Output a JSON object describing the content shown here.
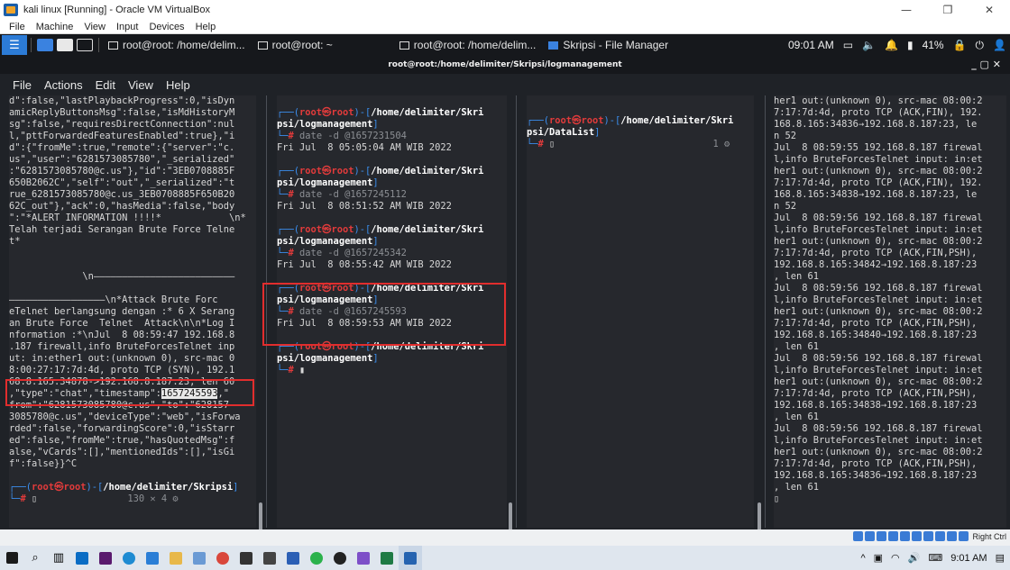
{
  "vbox": {
    "title": "kali linux [Running] - Oracle VM VirtualBox",
    "menu": [
      "File",
      "Machine",
      "View",
      "Input",
      "Devices",
      "Help"
    ],
    "right_ctrl": "Right Ctrl"
  },
  "kali_panel": {
    "tasks": [
      "root@root: /home/delim...",
      "root@root: ~",
      "root@root: /home/delim...",
      "Skripsi - File Manager"
    ],
    "clock": "09:01 AM",
    "battery": "41%"
  },
  "terminal": {
    "title": "root@root:/home/delimiter/Skripsi/logmanagement",
    "menu": [
      "File",
      "Actions",
      "Edit",
      "View",
      "Help"
    ]
  },
  "panes": {
    "pane1": {
      "lines_top": [
        "d\":false,\"lastPlaybackProgress\":0,\"isDyn",
        "amicReplyButtonsMsg\":false,\"isMdHistoryM",
        "sg\":false,\"requiresDirectConnection\":nul",
        "l,\"pttForwardedFeaturesEnabled\":true},\"i",
        "d\":{\"fromMe\":true,\"remote\":{\"server\":\"c.",
        "us\",\"user\":\"6281573085780\",\"_serialized\"",
        ":\"6281573085780@c.us\"},\"id\":\"3EB0708885F",
        "650B2062C\",\"self\":\"out\",\"_serialized\":\"t",
        "rue_6281573085780@c.us_3EB0708885F650B20",
        "62C_out\"},\"ack\":0,\"hasMedia\":false,\"body",
        "\":\"*ALERT INFORMATION !!!!*            \\n*",
        "Telah terjadi Serangan Brute Force Telne",
        "t*",
        "",
        "",
        "             \\n—————————————————————————",
        "",
        "—————————————————\\n*Attack Brute Forc",
        "eTelnet berlangsung dengan :* 6 X Serang",
        "an Brute Force  Telnet  Attack\\n\\n*Log I",
        "nformation :*\\nJul  8 08:59:47 192.168.8",
        ".187 firewall,info BruteForcesTelnet inp",
        "ut: in:ether1 out:(unknown 0), src-mac 0",
        "8:00:27:17:7d:4d, proto TCP (SYN), 192.1",
        "68.8.165:34878->192.168.8.187:23, len 60"
      ],
      "ts_prefix": ",\"type\":\"chat\",\"timestamp\":",
      "ts_value": "1657245593",
      "ts_suffix": ",\"",
      "lines_bottom": [
        "from\":\"6281573085780@c.us\",\"to\":\"628157",
        "3085780@c.us\",\"deviceType\":\"web\",\"isForwa",
        "rded\":false,\"forwardingScore\":0,\"isStarr",
        "ed\":false,\"fromMe\":true,\"hasQuotedMsg\":f",
        "alse,\"vCards\":[],\"mentionedIds\":[],\"isGi",
        "f\":false}}^C"
      ],
      "prompt_path": "/home/delimiter/Skripsi",
      "status": "130 ✕ 4 ⚙"
    },
    "pane2": {
      "entries": [
        {
          "path1": "/home/delimiter/Skri",
          "path2": "psi/logmanagement",
          "cmd": "date -d @1657231504",
          "out": "Fri Jul  8 05:05:04 AM WIB 2022"
        },
        {
          "path1": "/home/delimiter/Skri",
          "path2": "psi/logmanagement",
          "cmd": "date -d @1657245112",
          "out": "Fri Jul  8 08:51:52 AM WIB 2022"
        },
        {
          "path1": "/home/delimiter/Skri",
          "path2": "psi/logmanagement",
          "cmd": "date -d @1657245342",
          "out": "Fri Jul  8 08:55:42 AM WIB 2022"
        },
        {
          "path1": "/home/delimiter/Skri",
          "path2": "psi/logmanagement",
          "cmd": "date -d @1657245593",
          "out": "Fri Jul  8 08:59:53 AM WIB 2022"
        }
      ],
      "last_path1": "/home/delimiter/Skri",
      "last_path2": "psi/logmanagement"
    },
    "pane3": {
      "path1": "/home/delimiter/Skri",
      "path2": "psi/DataList",
      "status": "1 ⚙"
    },
    "pane4": {
      "lines": [
        "her1 out:(unknown 0), src-mac 08:00:2",
        "7:17:7d:4d, proto TCP (ACK,FIN), 192.",
        "168.8.165:34836→192.168.8.187:23, le",
        "n 52",
        "Jul  8 08:59:55 192.168.8.187 firewal",
        "l,info BruteForcesTelnet input: in:et",
        "her1 out:(unknown 0), src-mac 08:00:2",
        "7:17:7d:4d, proto TCP (ACK,FIN), 192.",
        "168.8.165:34838→192.168.8.187:23, le",
        "n 52",
        "Jul  8 08:59:56 192.168.8.187 firewal",
        "l,info BruteForcesTelnet input: in:et",
        "her1 out:(unknown 0), src-mac 08:00:2",
        "7:17:7d:4d, proto TCP (ACK,FIN,PSH),",
        "192.168.8.165:34842→192.168.8.187:23",
        ", len 61",
        "Jul  8 08:59:56 192.168.8.187 firewal",
        "l,info BruteForcesTelnet input: in:et",
        "her1 out:(unknown 0), src-mac 08:00:2",
        "7:17:7d:4d, proto TCP (ACK,FIN,PSH),",
        "192.168.8.165:34840→192.168.8.187:23",
        ", len 61",
        "Jul  8 08:59:56 192.168.8.187 firewal",
        "l,info BruteForcesTelnet input: in:et",
        "her1 out:(unknown 0), src-mac 08:00:2",
        "7:17:7d:4d, proto TCP (ACK,FIN,PSH),",
        "192.168.8.165:34838→192.168.8.187:23",
        ", len 61",
        "Jul  8 08:59:56 192.168.8.187 firewal",
        "l,info BruteForcesTelnet input: in:et",
        "her1 out:(unknown 0), src-mac 08:00:2",
        "7:17:7d:4d, proto TCP (ACK,FIN,PSH),",
        "192.168.8.165:34836→192.168.8.187:23",
        ", len 61"
      ]
    }
  },
  "prompt": {
    "user": "root",
    "host": "root"
  },
  "windows_taskbar": {
    "clock": "9:01 AM"
  }
}
